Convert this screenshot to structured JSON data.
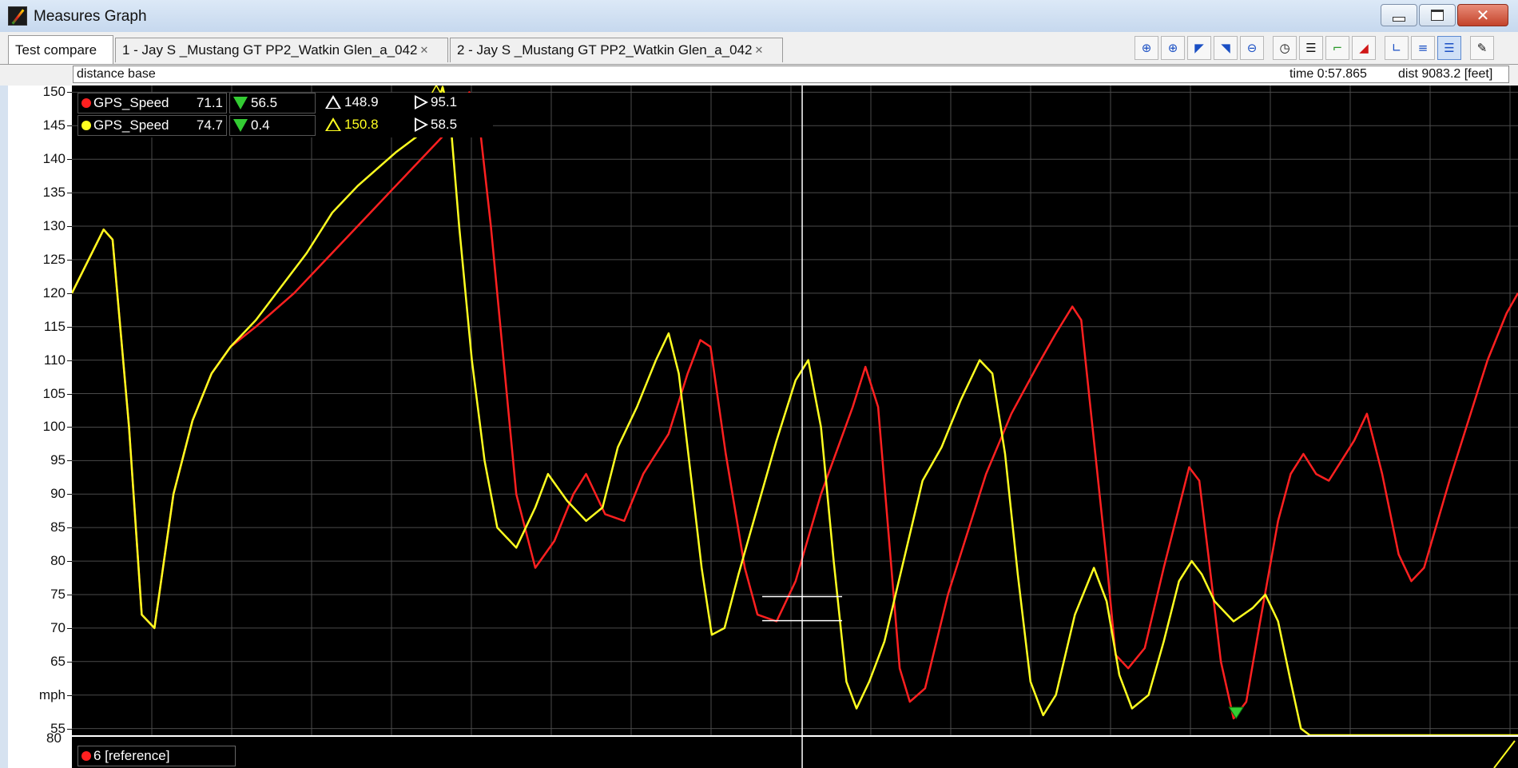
{
  "window": {
    "title": "Measures Graph"
  },
  "tabs": [
    {
      "label": "Test compare",
      "active": true
    },
    {
      "label": "1 - Jay S _Mustang GT PP2_Watkin Glen_a_042",
      "closable": true
    },
    {
      "label": "2 - Jay S _Mustang GT PP2_Watkin Glen_a_042",
      "closable": true
    }
  ],
  "toolbar_icons": [
    "zoom-fit-icon",
    "zoom-in-icon",
    "zoom-up-icon",
    "zoom-down-icon",
    "zoom-out-icon",
    "clock-icon",
    "stack-icon",
    "channel-icon",
    "ramp-icon",
    "axis-l-icon",
    "axis-split-icon",
    "list-icon",
    "wrench-icon"
  ],
  "infobar": {
    "mode": "distance base",
    "time": "time 0:57.865",
    "dist": "dist 9083.2 [feet]"
  },
  "legend": [
    {
      "channel": "GPS_Speed",
      "value": "71.1",
      "min": "56.5",
      "max": "148.9",
      "avg": "95.1",
      "color": "#ff2020",
      "max_color": "#ffffff"
    },
    {
      "channel": "GPS_Speed",
      "value": "74.7",
      "min": "0.4",
      "max": "150.8",
      "avg": "58.5",
      "color": "#ffff20",
      "max_color": "#ffff20"
    }
  ],
  "sub_graph": {
    "label": "6 [reference]",
    "top_tick": "80",
    "color": "#ff2020"
  },
  "colors": {
    "plot_bg": "#000000",
    "grid": "#4a4a4a",
    "cursor": "#ffffff",
    "lap1": "#ff2020",
    "lap2": "#ffff20"
  },
  "chart_data": {
    "type": "line",
    "ylabel": "mph",
    "ylim": [
      54,
      151
    ],
    "y_ticks": [
      "150",
      "145",
      "140",
      "135",
      "130",
      "125",
      "120",
      "115",
      "110",
      "105",
      "100",
      "95",
      "90",
      "85",
      "80",
      "75",
      "70",
      "65",
      "mph",
      "55"
    ],
    "grid": true,
    "cursor_fraction": 0.505,
    "series": [
      {
        "name": "GPS_Speed",
        "color": "#ff2020",
        "points": [
          [
            0.0,
            120
          ],
          [
            0.025,
            129.5
          ],
          [
            0.032,
            128
          ],
          [
            0.045,
            100
          ],
          [
            0.055,
            72
          ],
          [
            0.065,
            70
          ],
          [
            0.08,
            90
          ],
          [
            0.095,
            101
          ],
          [
            0.11,
            108
          ],
          [
            0.125,
            112
          ],
          [
            0.145,
            115
          ],
          [
            0.175,
            120
          ],
          [
            0.205,
            126
          ],
          [
            0.225,
            130
          ],
          [
            0.255,
            136
          ],
          [
            0.29,
            143
          ],
          [
            0.305,
            146
          ],
          [
            0.313,
            150
          ],
          [
            0.32,
            147
          ],
          [
            0.33,
            130
          ],
          [
            0.34,
            110
          ],
          [
            0.35,
            90
          ],
          [
            0.365,
            79
          ],
          [
            0.38,
            83
          ],
          [
            0.395,
            90
          ],
          [
            0.405,
            93
          ],
          [
            0.42,
            87
          ],
          [
            0.435,
            86
          ],
          [
            0.45,
            93
          ],
          [
            0.47,
            99
          ],
          [
            0.485,
            108
          ],
          [
            0.495,
            113
          ],
          [
            0.503,
            112
          ],
          [
            0.515,
            96
          ],
          [
            0.53,
            79
          ],
          [
            0.54,
            72
          ],
          [
            0.555,
            71
          ],
          [
            0.57,
            77
          ],
          [
            0.59,
            90
          ],
          [
            0.615,
            103
          ],
          [
            0.625,
            109
          ],
          [
            0.635,
            103
          ],
          [
            0.645,
            80
          ],
          [
            0.652,
            64
          ],
          [
            0.66,
            59
          ],
          [
            0.672,
            61
          ],
          [
            0.69,
            75
          ],
          [
            0.72,
            93
          ],
          [
            0.74,
            102
          ],
          [
            0.76,
            109
          ],
          [
            0.775,
            114
          ],
          [
            0.788,
            118
          ],
          [
            0.795,
            116
          ],
          [
            0.805,
            98
          ],
          [
            0.815,
            80
          ],
          [
            0.822,
            66
          ],
          [
            0.832,
            64
          ],
          [
            0.845,
            67
          ],
          [
            0.86,
            79
          ],
          [
            0.88,
            94
          ],
          [
            0.888,
            92
          ],
          [
            0.895,
            81
          ],
          [
            0.905,
            65
          ],
          [
            0.915,
            56.5
          ],
          [
            0.925,
            59
          ],
          [
            0.935,
            70
          ],
          [
            0.95,
            86
          ],
          [
            0.96,
            93
          ],
          [
            0.97,
            96
          ],
          [
            0.98,
            93
          ],
          [
            0.99,
            92
          ],
          [
            1.0,
            95
          ],
          [
            1.01,
            98
          ],
          [
            1.02,
            102
          ],
          [
            1.032,
            93
          ],
          [
            1.045,
            81
          ],
          [
            1.055,
            77
          ],
          [
            1.065,
            79
          ],
          [
            1.085,
            92
          ],
          [
            1.1,
            101
          ],
          [
            1.115,
            110
          ],
          [
            1.13,
            117
          ],
          [
            1.139,
            120
          ]
        ]
      },
      {
        "name": "GPS_Speed",
        "color": "#ffff20",
        "points": [
          [
            0.0,
            120
          ],
          [
            0.025,
            129.5
          ],
          [
            0.032,
            128
          ],
          [
            0.045,
            100
          ],
          [
            0.055,
            72
          ],
          [
            0.065,
            70
          ],
          [
            0.08,
            90
          ],
          [
            0.095,
            101
          ],
          [
            0.11,
            108
          ],
          [
            0.125,
            112
          ],
          [
            0.145,
            116
          ],
          [
            0.165,
            121
          ],
          [
            0.185,
            126
          ],
          [
            0.205,
            132
          ],
          [
            0.225,
            136
          ],
          [
            0.255,
            141
          ],
          [
            0.283,
            145
          ],
          [
            0.292,
            150.8
          ],
          [
            0.298,
            146
          ],
          [
            0.305,
            130
          ],
          [
            0.315,
            110
          ],
          [
            0.325,
            95
          ],
          [
            0.335,
            85
          ],
          [
            0.35,
            82
          ],
          [
            0.365,
            88
          ],
          [
            0.375,
            93
          ],
          [
            0.39,
            89
          ],
          [
            0.405,
            86
          ],
          [
            0.418,
            88
          ],
          [
            0.43,
            97
          ],
          [
            0.445,
            103
          ],
          [
            0.46,
            110
          ],
          [
            0.47,
            114
          ],
          [
            0.478,
            108
          ],
          [
            0.488,
            92
          ],
          [
            0.496,
            79
          ],
          [
            0.504,
            69
          ],
          [
            0.514,
            70
          ],
          [
            0.525,
            78
          ],
          [
            0.54,
            88
          ],
          [
            0.555,
            98
          ],
          [
            0.57,
            107
          ],
          [
            0.58,
            110
          ],
          [
            0.59,
            100
          ],
          [
            0.6,
            80
          ],
          [
            0.61,
            62
          ],
          [
            0.618,
            58
          ],
          [
            0.628,
            62
          ],
          [
            0.64,
            68
          ],
          [
            0.655,
            80
          ],
          [
            0.67,
            92
          ],
          [
            0.685,
            97
          ],
          [
            0.7,
            104
          ],
          [
            0.715,
            110
          ],
          [
            0.725,
            108
          ],
          [
            0.735,
            96
          ],
          [
            0.745,
            78
          ],
          [
            0.755,
            62
          ],
          [
            0.765,
            57
          ],
          [
            0.775,
            60
          ],
          [
            0.79,
            72
          ],
          [
            0.805,
            79
          ],
          [
            0.815,
            74
          ],
          [
            0.825,
            63
          ],
          [
            0.835,
            58
          ],
          [
            0.848,
            60
          ],
          [
            0.86,
            68
          ],
          [
            0.872,
            77
          ],
          [
            0.882,
            80
          ],
          [
            0.89,
            78
          ],
          [
            0.9,
            74
          ],
          [
            0.915,
            71
          ],
          [
            0.93,
            73
          ],
          [
            0.94,
            75
          ],
          [
            0.95,
            71
          ],
          [
            0.96,
            62
          ],
          [
            0.968,
            55
          ],
          [
            0.975,
            50
          ],
          [
            0.985,
            46
          ],
          [
            1.0,
            44
          ],
          [
            1.02,
            43
          ],
          [
            1.04,
            43
          ],
          [
            1.06,
            42
          ],
          [
            1.08,
            42
          ],
          [
            1.1,
            42
          ],
          [
            1.139,
            42
          ]
        ]
      }
    ],
    "markers": [
      {
        "label": "max",
        "series": 1,
        "x": 0.287,
        "y": 150.8,
        "color": "#ffff20"
      },
      {
        "label": "max",
        "series": 0,
        "x": 0.31,
        "y": 148.9,
        "color": "#ffffff"
      },
      {
        "label": "min",
        "series": 0,
        "x": 0.917,
        "y": 56.5,
        "color": "#33cc33"
      }
    ]
  }
}
